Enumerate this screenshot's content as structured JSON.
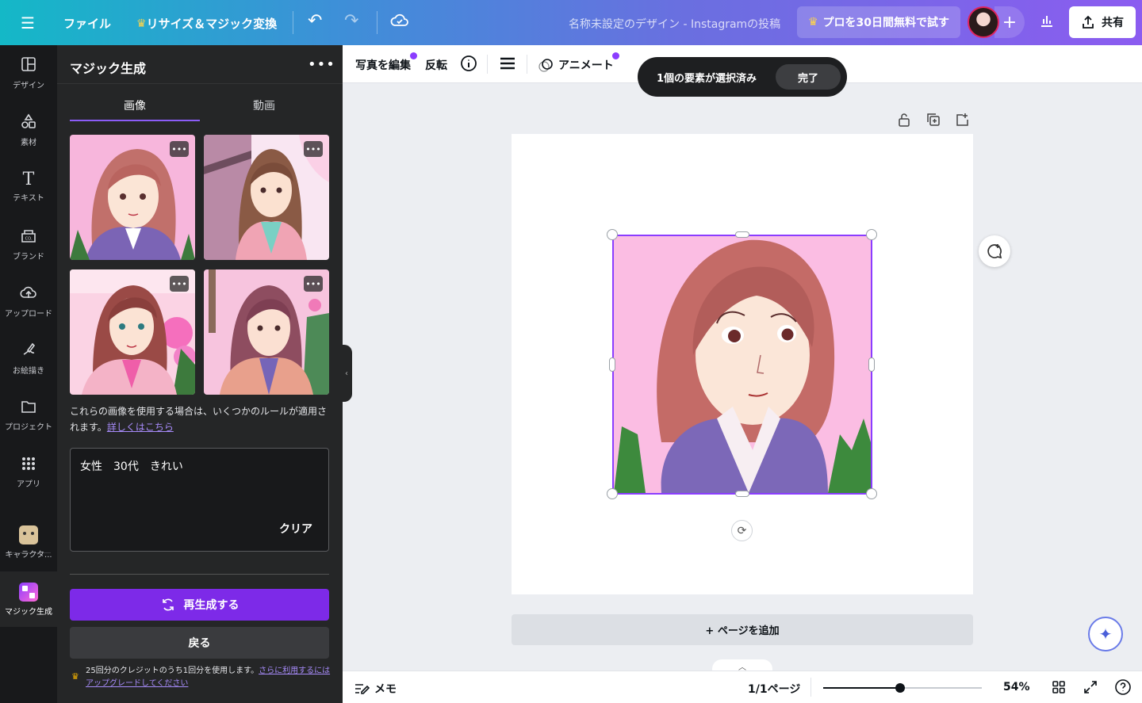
{
  "topbar": {
    "file_label": "ファイル",
    "resize_label": "リサイズ＆マジック変換",
    "doc_title": "名称未設定のデザイン - Instagramの投稿",
    "pro_trial_label": "プロを30日間無料で試す",
    "share_label": "共有"
  },
  "rail": {
    "items": [
      {
        "label": "デザイン",
        "icon": "layout-icon"
      },
      {
        "label": "素材",
        "icon": "elements-icon"
      },
      {
        "label": "テキスト",
        "icon": "text-icon"
      },
      {
        "label": "ブランド",
        "icon": "brand-icon"
      },
      {
        "label": "アップロード",
        "icon": "upload-icon"
      },
      {
        "label": "お絵描き",
        "icon": "draw-icon"
      },
      {
        "label": "プロジェクト",
        "icon": "folder-icon"
      },
      {
        "label": "アプリ",
        "icon": "apps-icon"
      },
      {
        "label": "キャラクタ...",
        "icon": "character-icon"
      },
      {
        "label": "マジック生成",
        "icon": "magic-media-icon"
      }
    ]
  },
  "panel": {
    "title": "マジック生成",
    "tabs": [
      "画像",
      "動画"
    ],
    "active_tab": "画像",
    "rules_text": "これらの画像を使用する場合は、いくつかのルールが適用されます。",
    "rules_link": "詳しくはこちら",
    "prompt_value": "女性　30代　きれい",
    "clear_label": "クリア",
    "regenerate_label": "再生成する",
    "back_label": "戻る",
    "credit_text": "25回分のクレジットのうち1回分を使用します。",
    "credit_link": "さらに利用するにはアップグレードしてください"
  },
  "toolbar": {
    "edit_photo_label": "写真を編集",
    "flip_label": "反転",
    "animate_label": "アニメート"
  },
  "toast": {
    "selected_label": "1個の要素が選択済み",
    "done_label": "完了"
  },
  "canvas": {
    "add_page_label": "+ ページを追加"
  },
  "bottombar": {
    "notes_label": "メモ",
    "page_indicator": "1/1ページ",
    "zoom_label": "54%",
    "zoom_value": 54
  },
  "colors": {
    "accent": "#8b3dff",
    "regen_button": "#7d2ae8",
    "panel_bg": "#252627",
    "rail_bg": "#18191b"
  }
}
